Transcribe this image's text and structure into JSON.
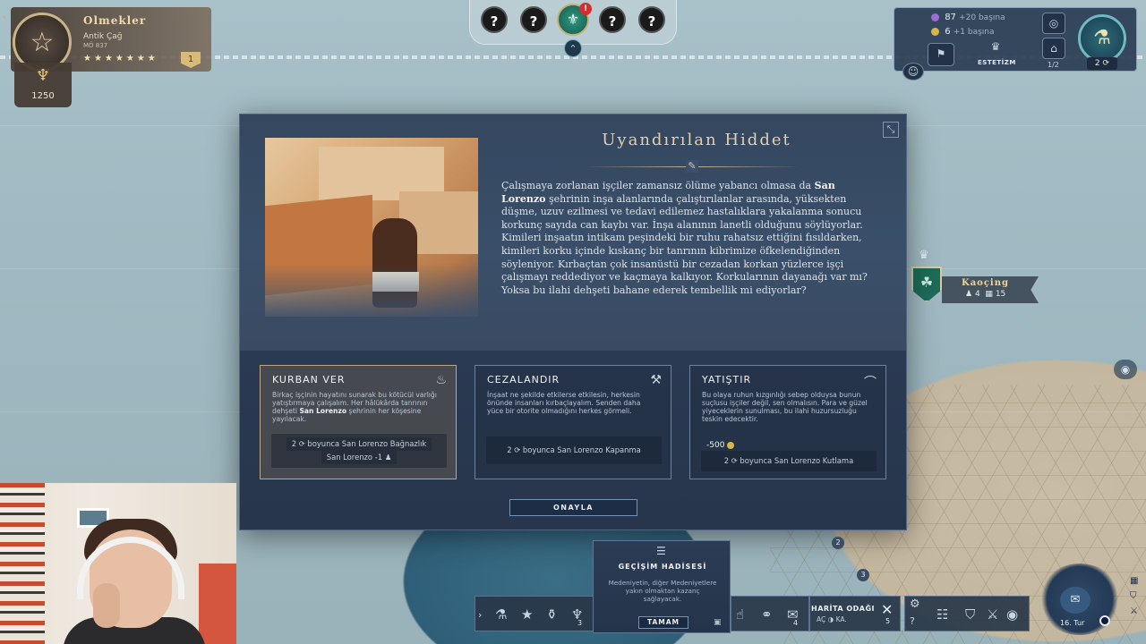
{
  "civ": {
    "name": "Olmekler",
    "era": "Antik Çağ",
    "year": "MÖ 837",
    "stars": "★★★★★★★",
    "badge": "1",
    "fame": "1250"
  },
  "notifications": {
    "items": [
      "?",
      "?",
      "?",
      "?"
    ],
    "alert_count": "!"
  },
  "resources": {
    "influence": {
      "value": "87",
      "gain": "+20 başına",
      "color": "#9b6bd6"
    },
    "money": {
      "value": "6",
      "gain": "+1 başına",
      "color": "#d7b44c"
    },
    "culture_label": "ESTETİZM",
    "page": "1/2",
    "research_turns": "2"
  },
  "city": {
    "name": "Kaoçing",
    "population": "4",
    "buildings": "15"
  },
  "event": {
    "title": "Uyandırılan Hiddet",
    "body_pre": "Çalışmaya zorlanan işçiler zamansız ölüme yabancı olmasa da ",
    "city_bold": "San Lorenzo",
    "body_post": " şehrinin inşa alanlarında çalıştırılanlar arasında, yüksekten düşme, uzuv ezilmesi ve tedavi edilemez hastalıklara yakalanma sonucu korkunç sayıda can kaybı var. İnşa alanının lanetli olduğunu söylüyorlar. Kimileri inşaatın intikam peşindeki bir ruhu rahatsız ettiğini fısıldarken, kimileri korku içinde kıskanç bir tanrının kibrimize öfkelendiğinden söyleniyor. Kırbaçtan çok insanüstü bir cezadan korkan yüzlerce işçi çalışmayı reddediyor ve kaçmaya kalkıyor. Korkularının dayanağı var mı? Yoksa bu ilahi dehşeti bahane ederek tembellik mi ediyorlar?",
    "choices": [
      {
        "title": "KURBAN VER",
        "desc_pre": "Birkaç işçinin hayatını sunarak bu kötücül varlığı yatıştırmaya çalışalım. Her hâlükârda tanrının dehşeti ",
        "desc_bold": "San Lorenzo",
        "desc_post": " şehrinin her köşesine yayılacak.",
        "effects": [
          "2 ⟳ boyunca San Lorenzo Bağnazlık",
          "San Lorenzo -1 ♟"
        ]
      },
      {
        "title": "CEZALANDIR",
        "desc": "İnşaat ne şekilde etkilerse etkilesin, herkesin önünde insanları kırbaçlayalım. Senden daha yüce bir otorite olmadığını herkes görmeli.",
        "effects": [
          "2 ⟳ boyunca San Lorenzo Kapanma"
        ]
      },
      {
        "title": "YATIŞTIR",
        "desc": "Bu olaya ruhun kızgınlığı sebep olduysa bunun suçlusu işçiler değil, sen olmalısın. Para ve güzel yiyeceklerin sunulması, bu ilahi huzursuzluğu teskin edecektir.",
        "cost": "-500",
        "effects": [
          "2 ⟳ boyunca San Lorenzo Kutlama"
        ]
      }
    ],
    "confirm": "ONAYLA"
  },
  "migration": {
    "title": "GEÇİŞİM HADİSESİ",
    "desc": "Medeniyetin, diğer Medeniyetlere yakın olmaktan kazanç sağlayacak.",
    "button": "TAMAM"
  },
  "hud": {
    "left_count": "3",
    "mid_count": "4",
    "map_focus_title": "HARİTA ODAĞI",
    "map_focus_state_off": "AÇ",
    "map_focus_state_on": "KA.",
    "map_focus_count": "5",
    "turn": "16. Tur",
    "hex_a": "2",
    "hex_b": "3"
  }
}
